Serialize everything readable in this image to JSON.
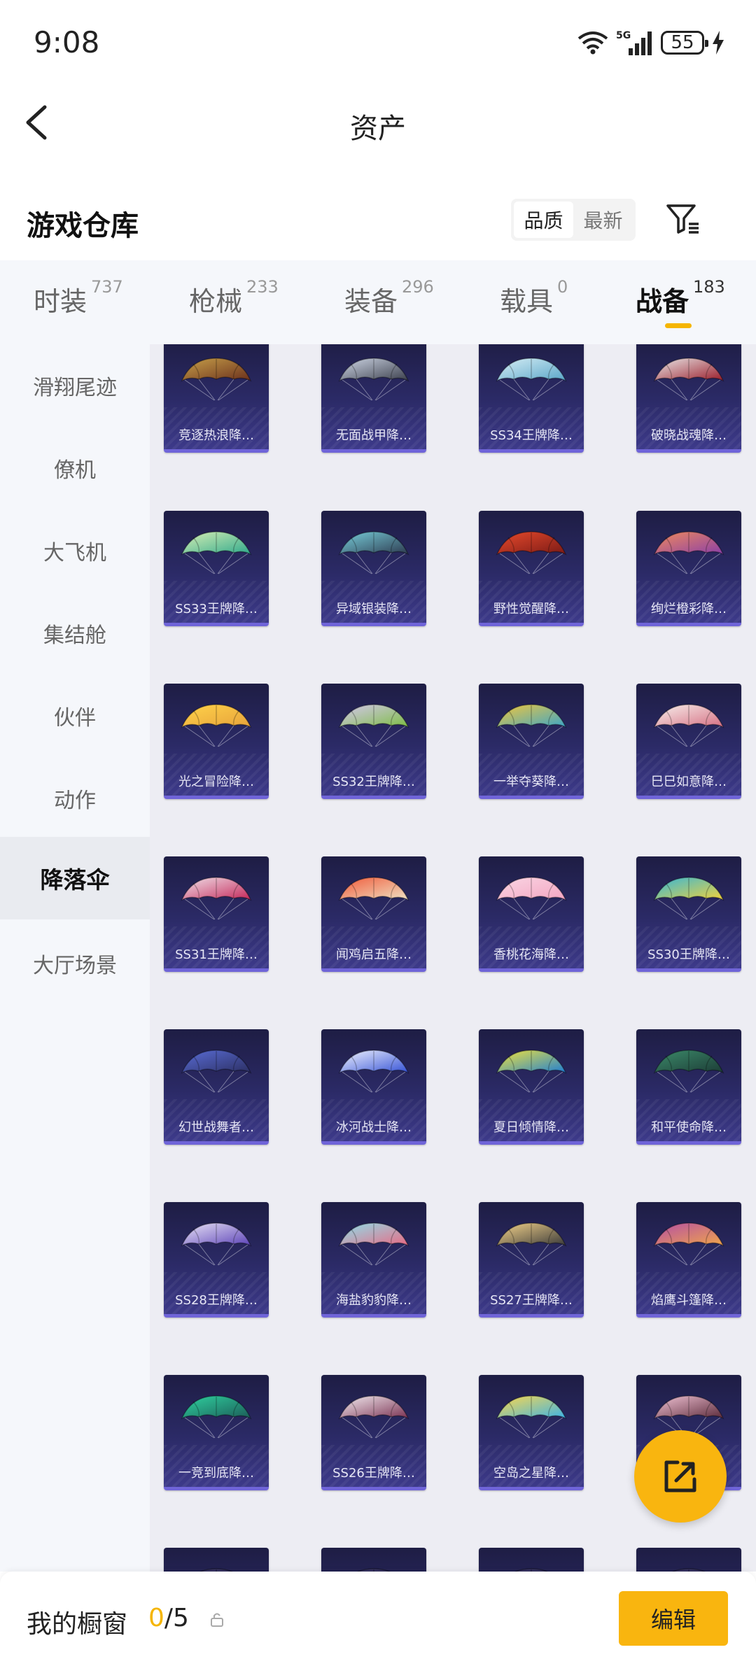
{
  "status_bar": {
    "time": "9:08",
    "battery": "55",
    "network": "5G"
  },
  "nav": {
    "title": "资产"
  },
  "section": {
    "title": "游戏仓库",
    "sort_options": [
      "品质",
      "最新"
    ],
    "sort_active": "品质"
  },
  "category_tabs": [
    {
      "label": "时装",
      "count": "737"
    },
    {
      "label": "枪械",
      "count": "233"
    },
    {
      "label": "装备",
      "count": "296"
    },
    {
      "label": "载具",
      "count": "0"
    },
    {
      "label": "战备",
      "count": "183",
      "active": true
    }
  ],
  "sidebar": {
    "items": [
      "滑翔尾迹",
      "僚机",
      "大飞机",
      "集结舱",
      "伙伴",
      "动作",
      "降落伞",
      "大厅场景"
    ],
    "active": "降落伞"
  },
  "items": [
    {
      "name": "竞逐热浪降…",
      "colors": [
        "#c8a14a",
        "#6a2f1c"
      ]
    },
    {
      "name": "无面战甲降…",
      "colors": [
        "#cfd7e6",
        "#3b3f4c"
      ]
    },
    {
      "name": "SS34王牌降…",
      "colors": [
        "#d7eef5",
        "#5aa6c9"
      ]
    },
    {
      "name": "破晓战魂降…",
      "colors": [
        "#e8e8e8",
        "#9a1c2a"
      ]
    },
    {
      "name": "SS33王牌降…",
      "colors": [
        "#d9efb5",
        "#2fa98c"
      ]
    },
    {
      "name": "异域银装降…",
      "colors": [
        "#78d0dc",
        "#2d3a4f"
      ]
    },
    {
      "name": "野性觉醒降…",
      "colors": [
        "#e84a2c",
        "#7a1a16"
      ]
    },
    {
      "name": "绚烂橙彩降…",
      "colors": [
        "#f08a5c",
        "#8a3fa8"
      ]
    },
    {
      "name": "光之冒险降…",
      "colors": [
        "#ffd34a",
        "#e7a23b"
      ]
    },
    {
      "name": "SS32王牌降…",
      "colors": [
        "#d6c7f0",
        "#7dbd44"
      ]
    },
    {
      "name": "一举夺葵降…",
      "colors": [
        "#f3c63b",
        "#3ca6c9"
      ]
    },
    {
      "name": "巳巳如意降…",
      "colors": [
        "#f7f1ee",
        "#d66f82"
      ]
    },
    {
      "name": "SS31王牌降…",
      "colors": [
        "#f0e3ea",
        "#c42659"
      ]
    },
    {
      "name": "闻鸡启五降…",
      "colors": [
        "#f05a3a",
        "#efe2c4"
      ]
    },
    {
      "name": "香桃花海降…",
      "colors": [
        "#f9d6e4",
        "#f4a6c2"
      ]
    },
    {
      "name": "SS30王牌降…",
      "colors": [
        "#35b6d9",
        "#f1d23c"
      ]
    },
    {
      "name": "幻世战舞者…",
      "colors": [
        "#5a6dd6",
        "#2c2f63"
      ]
    },
    {
      "name": "冰河战士降…",
      "colors": [
        "#f2f5ff",
        "#3552d6"
      ]
    },
    {
      "name": "夏日倾情降…",
      "colors": [
        "#f3e43b",
        "#1f7fd4"
      ]
    },
    {
      "name": "和平使命降…",
      "colors": [
        "#3c8a6a",
        "#1c3c36"
      ]
    },
    {
      "name": "SS28王牌降…",
      "colors": [
        "#e9e4f6",
        "#5c43b8"
      ]
    },
    {
      "name": "海盐豹豹降…",
      "colors": [
        "#8ee0ec",
        "#e86a84"
      ]
    },
    {
      "name": "SS27王牌降…",
      "colors": [
        "#f6d48a",
        "#3a3a3a"
      ]
    },
    {
      "name": "焰鹰斗篷降…",
      "colors": [
        "#b44ea6",
        "#f0a54a"
      ]
    },
    {
      "name": "一竞到底降…",
      "colors": [
        "#2fd3a0",
        "#1c5c58"
      ]
    },
    {
      "name": "SS26王牌降…",
      "colors": [
        "#f4eef2",
        "#7a3152"
      ]
    },
    {
      "name": "空岛之星降…",
      "colors": [
        "#ffd84a",
        "#3cb3e8"
      ]
    },
    {
      "name": "",
      "colors": [
        "#f2c4d6",
        "#5b2a3a"
      ]
    },
    {
      "name": "",
      "colors": [
        "#3a3566",
        "#2a2850"
      ]
    },
    {
      "name": "",
      "colors": [
        "#3a3566",
        "#2a2850"
      ]
    },
    {
      "name": "",
      "colors": [
        "#3a3566",
        "#2a2850"
      ]
    },
    {
      "name": "",
      "colors": [
        "#3a3566",
        "#2a2850"
      ]
    }
  ],
  "bottom": {
    "label": "我的橱窗",
    "current": "0",
    "total": "/5",
    "edit_label": "编辑"
  },
  "accent": "#f9b50f"
}
